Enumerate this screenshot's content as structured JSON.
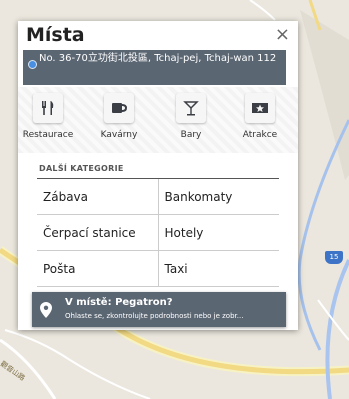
{
  "panel": {
    "title": "Místa",
    "close_label": "×",
    "address": "No. 36-70立功街北投區, Tchaj-pej, Tchaj-wan 112"
  },
  "categories": [
    {
      "label": "Restaurace",
      "icon": "restaurant-icon"
    },
    {
      "label": "Kavárny",
      "icon": "coffee-icon"
    },
    {
      "label": "Bary",
      "icon": "bar-icon"
    },
    {
      "label": "Atrakce",
      "icon": "attraction-icon"
    }
  ],
  "more": {
    "header": "DALŠÍ KATEGORIE",
    "rows": [
      [
        "Zábava",
        "Bankomaty"
      ],
      [
        "Čerpací stanice",
        "Hotely"
      ],
      [
        "Pošta",
        "Taxi"
      ]
    ]
  },
  "toast": {
    "title": "V místě: Pegatron?",
    "message": "Ohlaste se, zkontrolujte podrobnosti nebo je zobr..."
  },
  "map": {
    "road_shield": "15",
    "road_label": "觀音山路"
  }
}
